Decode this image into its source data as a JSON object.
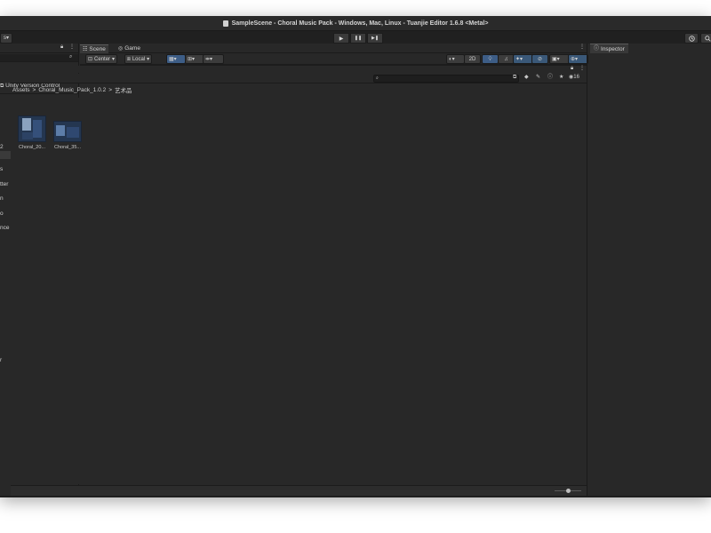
{
  "window": {
    "title": "SampleScene - Choral Music Pack - Windows, Mac, Linux - Tuanjie Editor 1.6.8 <Metal>"
  },
  "toolbar": {
    "left_dropdown": "s",
    "history_icon": "history-icon",
    "play_icon": "▶",
    "pause_icon": "❚❚",
    "step_icon": "▶❚"
  },
  "hierarchy": {
    "rows": [
      {
        "label": "Unity Version Control"
      },
      {
        "label": "2"
      },
      {
        "label": "s"
      },
      {
        "label": "tter"
      },
      {
        "label": "n"
      },
      {
        "label": "o"
      },
      {
        "label": "nce"
      },
      {
        "label": "r"
      }
    ]
  },
  "scene_tabs": {
    "scene": "Scene",
    "game": "Game"
  },
  "scene_toolbar": {
    "center": "Center",
    "local": "Local",
    "mode_2d": "2D"
  },
  "project": {
    "count": "16",
    "breadcrumb": [
      "Assets",
      "Choral_Music_Pack_1.0.2",
      "艺术品"
    ],
    "separator": ">",
    "assets": [
      {
        "name": "Choral_20..."
      },
      {
        "name": "Choral_35..."
      }
    ]
  },
  "inspector": {
    "tab": "Inspector"
  },
  "colors": {
    "panel": "#282828",
    "toolbar": "#202020",
    "accent_blue": "#3d5d86",
    "thumb_blue": "#243650"
  }
}
